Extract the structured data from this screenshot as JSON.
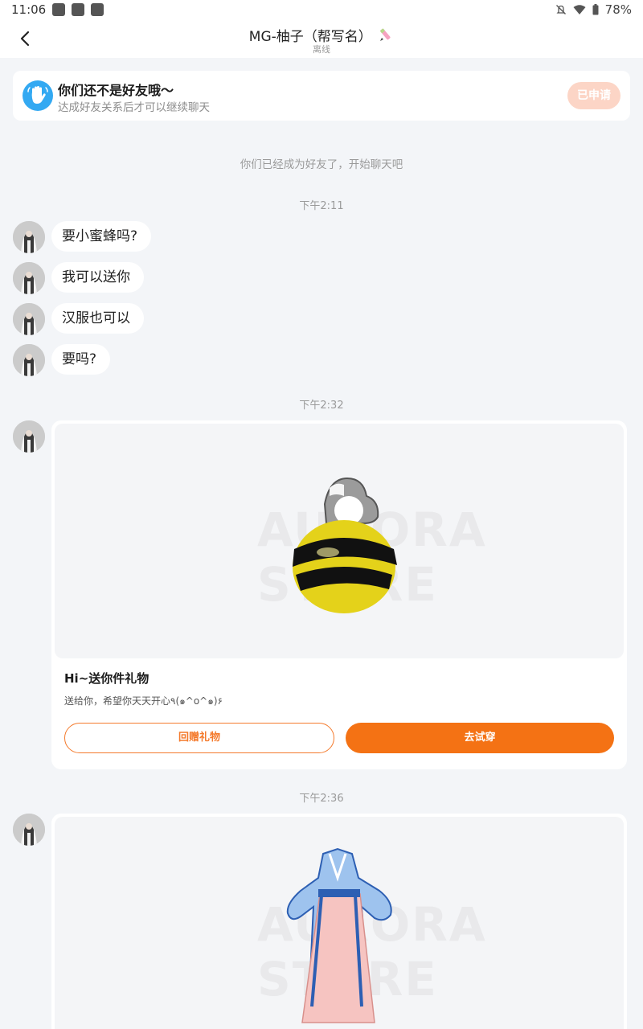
{
  "status_bar": {
    "time": "11:06",
    "battery": "78%",
    "icons": [
      "notification-square-icon",
      "notification-square-icon",
      "notification-square-icon",
      "mute-icon",
      "wifi-icon",
      "battery-icon"
    ]
  },
  "header": {
    "title": "MG-柚子（帮写名）",
    "status": "离线",
    "back_icon": "back-arrow-icon",
    "title_emoji": "pen-emoji-icon"
  },
  "friend_banner": {
    "title": "你们还不是好友哦～",
    "subtitle": "达成好友关系后才可以继续聊天",
    "button_label": "已申请",
    "icon": "wave-hand-icon"
  },
  "system_message": "你们已经成为好友了，开始聊天吧",
  "timestamps": [
    "下午2:11",
    "下午2:32",
    "下午2:36"
  ],
  "messages": [
    {
      "text": "要小蜜蜂吗?"
    },
    {
      "text": "我可以送你"
    },
    {
      "text": "汉服也可以"
    },
    {
      "text": "要吗?"
    }
  ],
  "gift_card_1": {
    "item": "bee-costume-image",
    "watermark": "AURORA STORE",
    "title": "Hi~送你件礼物",
    "description": "送给你，希望你天天开心٩(๑^o^๑)۶",
    "return_gift_label": "回赠礼物",
    "try_on_label": "去试穿"
  },
  "gift_card_2": {
    "item": "hanfu-dress-image",
    "watermark": "AURORA STORE"
  },
  "colors": {
    "accent": "#f47214",
    "banner_icon": "#33a9f2",
    "applied_button": "#fcd5c6",
    "background": "#f3f5f8"
  }
}
